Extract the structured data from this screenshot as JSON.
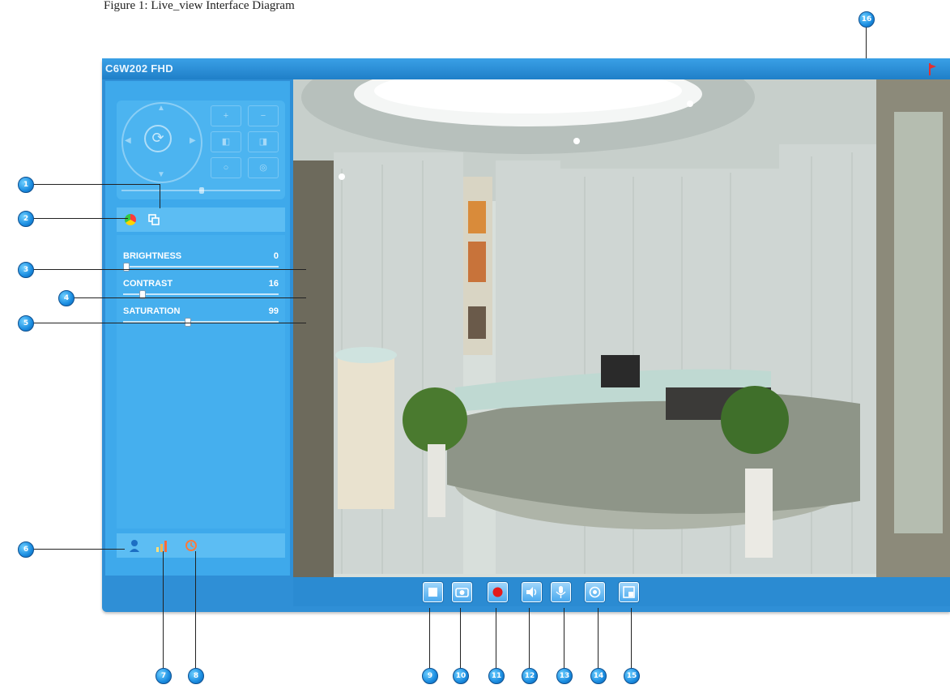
{
  "caption": "Figure 1: Live_view Interface Diagram",
  "app": {
    "title": "C6W202 FHD",
    "accent_color": "#2f8fd6",
    "title_icon": "flag-icon"
  },
  "ptz": {
    "center_icon": "rotate-icon",
    "buttons": [
      "zoom-in-icon",
      "zoom-out-icon",
      "focus-near-icon",
      "focus-far-icon",
      "iris-open-icon",
      "iris-close-icon"
    ]
  },
  "image_settings": {
    "tabs": [
      "color-settings-icon",
      "copy-icon"
    ],
    "sliders": [
      {
        "label": "BRIGHTNESS",
        "value": "0",
        "level_pct": 0
      },
      {
        "label": "CONTRAST",
        "value": "16",
        "level_pct": 11
      },
      {
        "label": "SATURATION",
        "value": "99",
        "level_pct": 40
      }
    ]
  },
  "bottom_tabs": [
    "user-icon",
    "signal-icon",
    "alarm-icon"
  ],
  "toolbar": [
    "stop-icon",
    "snapshot-icon",
    "record-icon",
    "audio-icon",
    "talk-icon",
    "mirror-icon",
    "settings-icon"
  ],
  "callouts": [
    "1",
    "2",
    "3",
    "4",
    "5",
    "6",
    "7",
    "8",
    "9",
    "10",
    "11",
    "12",
    "13",
    "14",
    "15",
    "16"
  ]
}
